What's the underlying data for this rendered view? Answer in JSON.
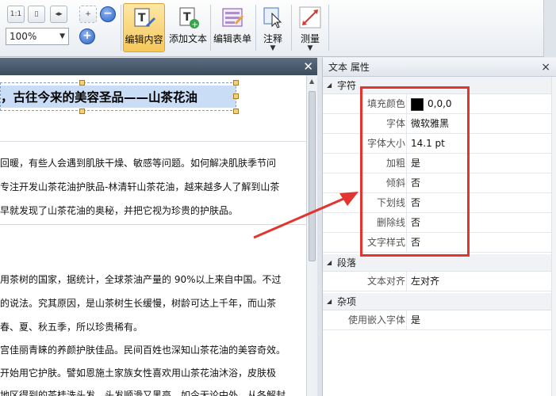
{
  "toolbar": {
    "zoom_value": "100%",
    "buttons": {
      "edit_content": "编辑内容",
      "add_text": "添加文本",
      "edit_form": "编辑表单",
      "annotate": "注释",
      "measure": "测量"
    },
    "small_icons": [
      "actual-size-icon",
      "fit-page-icon",
      "fit-width-icon",
      "marquee-zoom-icon",
      "zoom-out-icon",
      "zoom-in-icon"
    ]
  },
  "document": {
    "title": "，古往今来的美容圣品——山茶花油",
    "lines": [
      "回暖，有些人会遇到肌肤干燥、敏感等问题。如何解决肌肤季节问",
      "专注开发山茶花油护肤品-林清轩山茶花油，越来越多人了解到山茶",
      "早就发现了山茶花油的奥秘，并把它视为珍贵的护肤品。",
      "用茶树的国家，据统计，全球茶油产量的 90%以上来自中国。不过",
      "的说法。究其原因，是山茶树生长缓慢，树龄可达上千年，而山茶",
      "春、夏、秋五季，所以珍贵稀有。",
      "宫佳丽青睐的养颜护肤佳品。民间百姓也深知山茶花油的美容奇效。",
      "开始用它护肤。譬如恩施土家族女性喜欢用山茶花油沐浴，皮肤极",
      "地区得到的茶桂洗头发，头发顺滑又黑亮，如今无论中外，从各解封"
    ]
  },
  "properties": {
    "title": "文本 属性",
    "sections": {
      "character": "字符",
      "paragraph": "段落",
      "misc": "杂项"
    },
    "character_rows": [
      {
        "key": "填充颜色",
        "value": "0,0,0"
      },
      {
        "key": "字体",
        "value": "微软雅黑"
      },
      {
        "key": "字体大小",
        "value": "14.1 pt"
      },
      {
        "key": "加粗",
        "value": "是"
      },
      {
        "key": "倾斜",
        "value": "否"
      },
      {
        "key": "下划线",
        "value": "否"
      },
      {
        "key": "删除线",
        "value": "否"
      },
      {
        "key": "文字样式",
        "value": "否"
      }
    ],
    "paragraph_rows": [
      {
        "key": "文本对齐",
        "value": "左对齐"
      }
    ],
    "misc_rows": [
      {
        "key": "使用嵌入字体",
        "value": "是"
      }
    ],
    "fill_color_hex": "#000000"
  },
  "colors": {
    "highlight_box": "#e2352f",
    "active_button": "#f6c85a"
  }
}
